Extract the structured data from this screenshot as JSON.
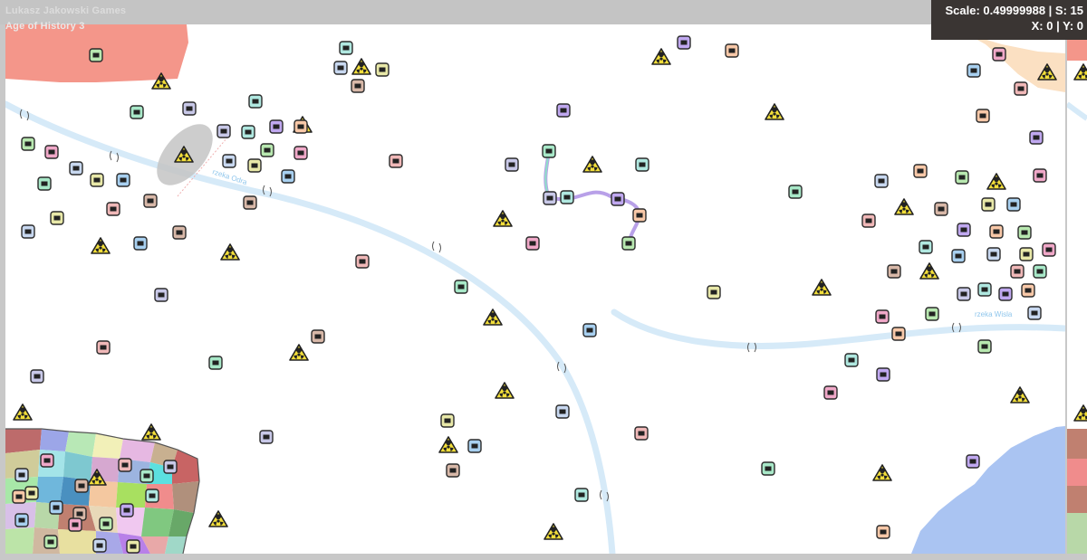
{
  "watermark": {
    "studio": "Lukasz Jakowski Games",
    "game": "Age of History 3"
  },
  "hud": {
    "scale_label": "Scale: 0.49999988 | S: 15",
    "coords_label": "X: 0 | Y: 0"
  },
  "map": {
    "rivers": [
      {
        "label": "rzeka Odra"
      },
      {
        "label": "rzeka Wisla"
      }
    ],
    "colors": {
      "background": "#ffffff",
      "river": "#d6eaf8",
      "sea": "#aac4f2",
      "hazard": "#f2de3a"
    },
    "icons": [
      "city-marker-icon",
      "radiation-hazard-icon",
      "bridge-icon"
    ]
  }
}
